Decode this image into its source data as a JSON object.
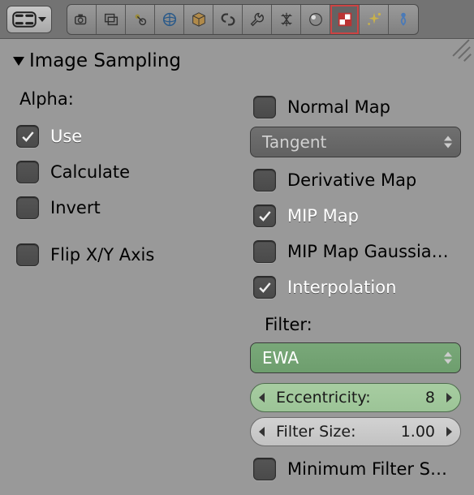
{
  "panel_title": "Image Sampling",
  "alpha": {
    "label": "Alpha:",
    "use": {
      "label": "Use",
      "checked": true
    },
    "calculate": {
      "label": "Calculate",
      "checked": false
    },
    "invert": {
      "label": "Invert",
      "checked": false
    }
  },
  "flip_xy": {
    "label": "Flip X/Y Axis",
    "checked": false
  },
  "normal_map": {
    "label": "Normal Map",
    "checked": false
  },
  "normal_map_space": "Tangent",
  "derivative_map": {
    "label": "Derivative Map",
    "checked": false
  },
  "mip_map": {
    "label": "MIP Map",
    "checked": true
  },
  "mip_map_gauss": {
    "label": "MIP Map Gaussia…",
    "checked": false
  },
  "interpolation": {
    "label": "Interpolation",
    "checked": true
  },
  "filter": {
    "label": "Filter:",
    "type": "EWA",
    "eccentricity": {
      "label": "Eccentricity:",
      "value": "8"
    },
    "size": {
      "label": "Filter Size:",
      "value": "1.00"
    },
    "minimum": {
      "label": "Minimum Filter S…",
      "checked": false
    }
  },
  "header_icons": [
    "render-icon",
    "scene-icon",
    "world-icon",
    "globe-icon",
    "object-icon",
    "constraint-icon",
    "modifier-icon",
    "data-icon",
    "material-icon",
    "texture-icon",
    "particles-icon",
    "physics-icon"
  ]
}
